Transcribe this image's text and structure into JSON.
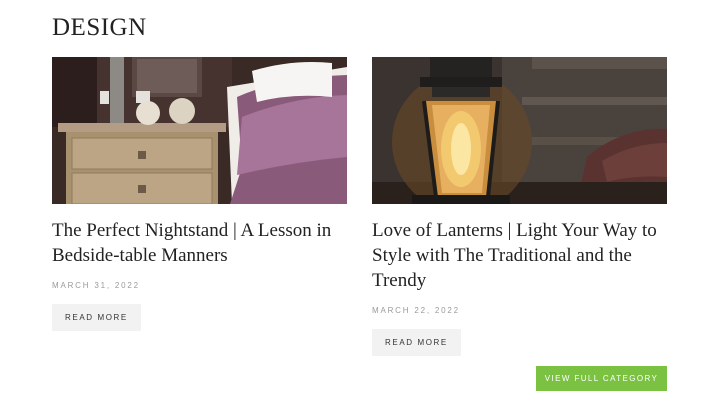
{
  "section": {
    "title": "DESIGN"
  },
  "posts": [
    {
      "title": "The Perfect Nightstand | A Lesson in Bedside-table Manners",
      "date": "MARCH 31, 2022",
      "read_more": "READ MORE",
      "image": "nightstand-photo"
    },
    {
      "title": "Love of Lanterns | Light Your Way to Style with The Traditional and the Trendy",
      "date": "MARCH 22, 2022",
      "read_more": "READ MORE",
      "image": "lantern-photo"
    }
  ],
  "cta": {
    "label": "VIEW FULL CATEGORY",
    "color": "#7cc242"
  }
}
